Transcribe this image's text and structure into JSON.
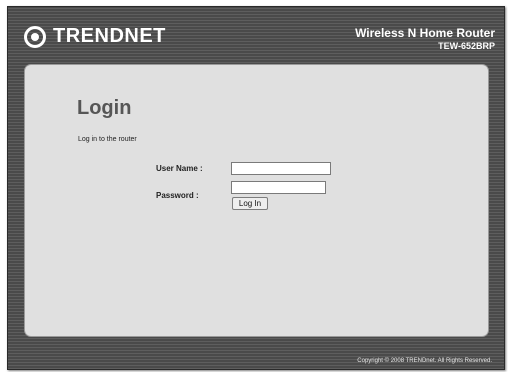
{
  "header": {
    "brand": "TRENDNET",
    "product_name": "Wireless N Home Router",
    "model": "TEW-652BRP"
  },
  "login": {
    "title": "Login",
    "subtitle": "Log in to the router",
    "username_label": "User Name :",
    "username_value": "",
    "password_label": "Password :",
    "password_value": "",
    "button_label": "Log In"
  },
  "footer": {
    "copyright": "Copyright © 2008 TRENDnet. All Rights Reserved."
  },
  "colors": {
    "frame": "#4a4a4a",
    "panel": "#e0e0e0",
    "title": "#565656"
  }
}
